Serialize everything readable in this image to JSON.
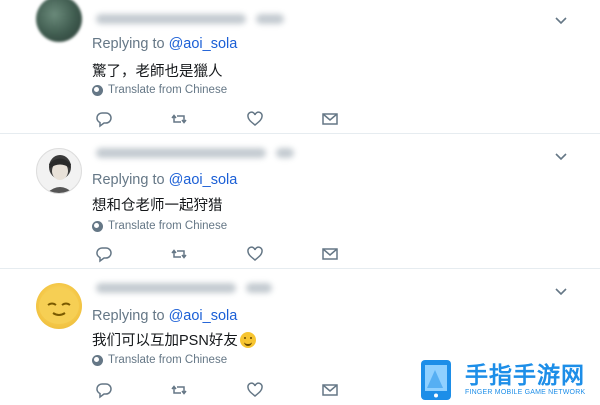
{
  "tweets": [
    {
      "reply_prefix": "Replying to",
      "reply_handle": "@aoi_sola",
      "text": "驚了，老師也是獵人",
      "translate": "Translate from Chinese"
    },
    {
      "reply_prefix": "Replying to",
      "reply_handle": "@aoi_sola",
      "text": "想和仓老师一起狩猎",
      "translate": "Translate from Chinese"
    },
    {
      "reply_prefix": "Replying to",
      "reply_handle": "@aoi_sola",
      "text": "我们可以互加PSN好友",
      "translate": "Translate from Chinese"
    }
  ],
  "icons": {
    "reply": "reply-icon",
    "retweet": "retweet-icon",
    "like": "heart-icon",
    "dm": "envelope-icon",
    "caret": "chevron-down-icon",
    "translate": "globe-icon",
    "emoji": "winking-face-emoji"
  },
  "watermark": {
    "logo_text": "手指手游网",
    "tagline": "FINGER MOBILE GAME NETWORK"
  },
  "colors": {
    "handle": "#1b5fd6",
    "secondary_text": "#657786",
    "divider": "#e6ecf0",
    "watermark": "#1d8ee8"
  }
}
